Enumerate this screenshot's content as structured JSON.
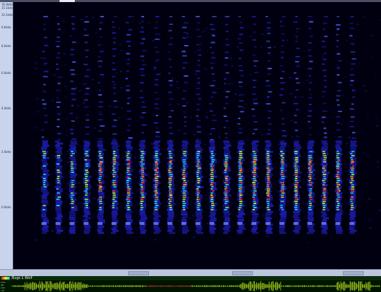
{
  "frequency_axis": {
    "ticks": [
      {
        "label": "16.0kHz"
      },
      {
        "label": "15.1kHz"
      },
      {
        "label": "12.1kHz"
      },
      {
        "label": "9.6kHz"
      },
      {
        "label": "8.0kHz"
      },
      {
        "label": "6.0kHz"
      },
      {
        "label": "4.0kHz"
      },
      {
        "label": "2.0kHz"
      },
      {
        "label": "0.0kHz"
      }
    ]
  },
  "waveform_track": {
    "name": "Bugs 1 Wolf",
    "channel_labels": [
      "Amp",
      "dB",
      "100",
      "-10"
    ]
  },
  "colors": {
    "background": "#000010",
    "low": "#1a1aa8",
    "mid": "#a8e820",
    "high": "#e82020",
    "waveform": "#b8e020"
  }
}
